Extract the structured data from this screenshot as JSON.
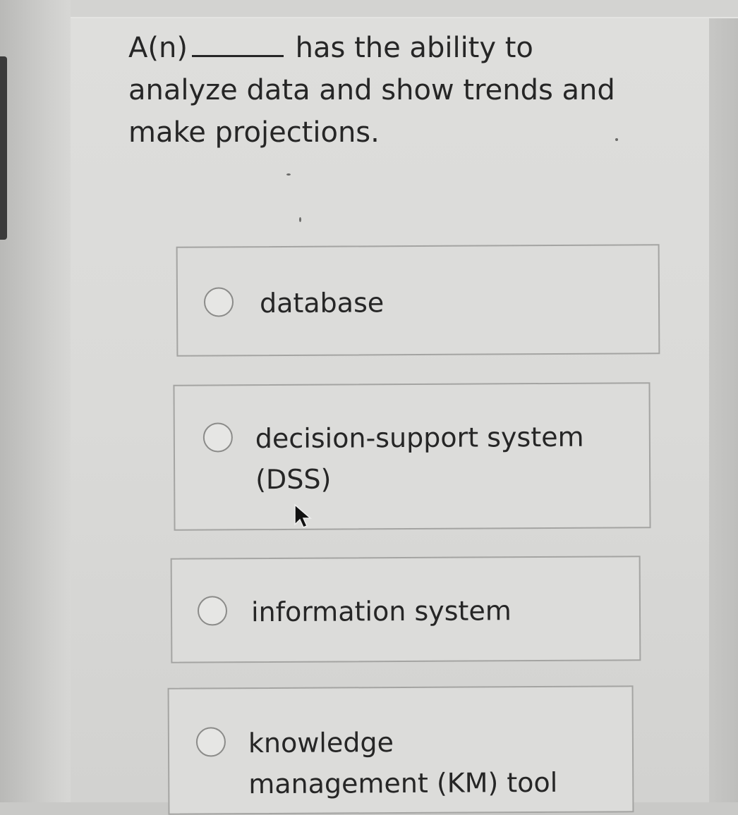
{
  "question": {
    "prefix": "A(n)",
    "suffix": "has the ability to analyze data and show trends and make projections."
  },
  "options": [
    {
      "label": "database",
      "selected": false
    },
    {
      "label": "decision-support system (DSS)",
      "selected": false
    },
    {
      "label": "information system",
      "selected": false
    },
    {
      "label": "knowledge management (KM) tool",
      "selected": false
    }
  ]
}
